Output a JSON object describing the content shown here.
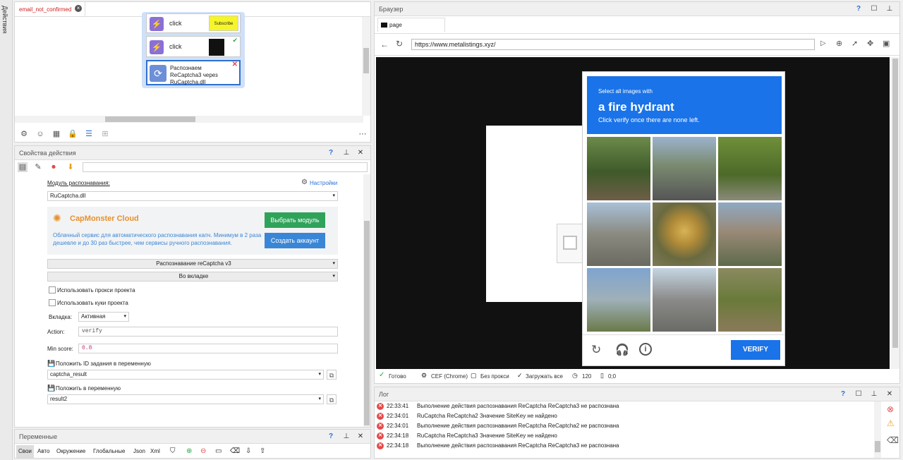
{
  "sidebar": {
    "actions_label": "Действия"
  },
  "project": {
    "tab_title": "email_not_confirmed",
    "nodes": [
      {
        "label": "click",
        "thumb_text": "Subscribe"
      },
      {
        "label": "click",
        "thumb_text": ""
      },
      {
        "label": "Распознаем ReCaptcha3 через RuCaptcha.dll"
      }
    ]
  },
  "props": {
    "title": "Свойства действия",
    "module_label": "Модуль распознавания:",
    "settings_link": "Настройки",
    "module_value": "RuCaptcha.dll",
    "capmonster": {
      "name": "CapMonster Cloud",
      "description": "Облачный сервис для автоматического распознавания капч. Минимум в 2 раза дешевле и до 30 раз быстрее, чем сервисы ручного распознавания.",
      "choose_button": "Выбрать модуль",
      "create_button": "Создать аккаунт"
    },
    "recognition_type": "Распознавание reCaptcha v3",
    "mode": "Во вкладке",
    "use_proxy": "Использовать прокси проекта",
    "use_cookies": "Использовать куки проекта",
    "tab_label": "Вкладка:",
    "tab_value": "Активная",
    "action_label": "Action:",
    "action_value": "verify",
    "minscore_label": "Min score:",
    "minscore_value": "0.8",
    "task_id_label": "Положить ID задания в переменную",
    "task_id_value": "captcha_result",
    "result_label": "Положить в переменную",
    "result_value": "result2"
  },
  "variables": {
    "title": "Переменные",
    "tabs": [
      "Свои",
      "Авто",
      "Окружение",
      "Глобальные",
      "Json",
      "Xml"
    ]
  },
  "browser": {
    "title": "Браузер",
    "tab_label": "page",
    "url": "https://www.metalistings.xyz/",
    "captcha": {
      "prompt_small": "Select all images with",
      "prompt_big": "a fire hydrant",
      "prompt_sub": "Click verify once there are none left.",
      "verify": "VERIFY"
    },
    "status": {
      "ready": "Готово",
      "engine": "CEF (Chrome)",
      "proxy": "Без прокси",
      "load": "Загружать все",
      "count": "120",
      "coords": "0;0"
    }
  },
  "log": {
    "title": "Лог",
    "rows": [
      {
        "time": "22:33:41",
        "msg": "Выполнение действия распознавания ReCaptcha ReCaptcha3 не распознана"
      },
      {
        "time": "22:34:01",
        "msg": "RuCaptcha ReCaptcha2 Значение SiteKey не найдено"
      },
      {
        "time": "22:34:01",
        "msg": "Выполнение действия распознавания ReCaptcha ReCaptcha2 не распознана"
      },
      {
        "time": "22:34:18",
        "msg": "RuCaptcha ReCaptcha3 Значение SiteKey не найдено"
      },
      {
        "time": "22:34:18",
        "msg": "Выполнение действия распознавания ReCaptcha ReCaptcha3 не распознана"
      }
    ]
  },
  "colors": {
    "accent": "#1a73e8",
    "error": "#e34a4a",
    "capmonster_green": "#2fa35a",
    "capmonster_blue": "#3a86d6"
  }
}
